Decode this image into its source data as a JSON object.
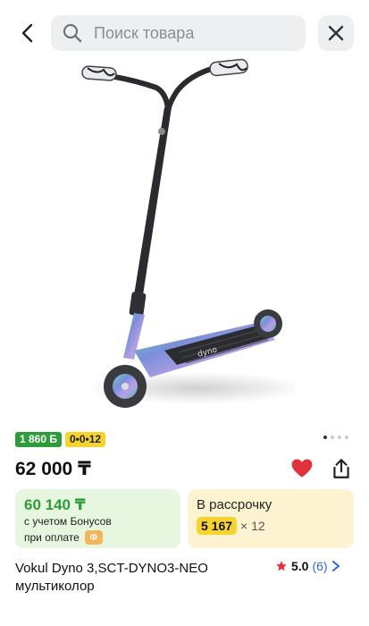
{
  "header": {
    "search_placeholder": "Поиск товара",
    "icons": {
      "back": "chevron-left-icon",
      "search": "search-icon",
      "close": "close-icon"
    }
  },
  "gallery": {
    "image": "scooter-product-image",
    "slides_total": 4,
    "active_slide": 1
  },
  "badges": {
    "bonus": "1 860 Б",
    "installment": "0•0•12"
  },
  "price": "62 000 ₸",
  "actions": {
    "favorite": "heart-icon",
    "share": "share-icon"
  },
  "bonus_card": {
    "price": "60 140 ₸",
    "note_line1": "с учетом Бонусов",
    "note_line2": "при оплате",
    "coin_label": "Ф"
  },
  "installment_card": {
    "title": "В рассрочку",
    "amount": "5 167",
    "months": "× 12"
  },
  "product": {
    "title": "Vokul Dyno 3,SCT-DYNO3-NEO мультиколор",
    "rating": "5.0",
    "reviews": "(6)"
  },
  "colors": {
    "accent_green": "#2e9c3a",
    "accent_yellow": "#f7d32f",
    "heart_red": "#e0323c",
    "link_blue": "#2f6bd8"
  }
}
